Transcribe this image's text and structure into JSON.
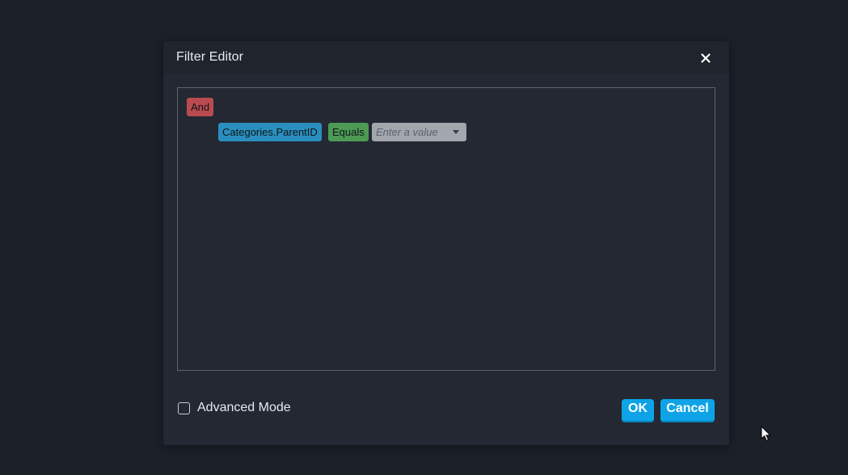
{
  "dialog": {
    "title": "Filter Editor",
    "close_icon": "close-icon"
  },
  "filter": {
    "group_operator": "And",
    "condition": {
      "field": "Categories.ParentID",
      "operator": "Equals",
      "value_placeholder": "Enter a value",
      "value_dropdown_icon": "caret-down-icon"
    }
  },
  "footer": {
    "advanced_mode_label": "Advanced Mode",
    "advanced_mode_checked": false,
    "ok_label": "OK",
    "cancel_label": "Cancel"
  },
  "colors": {
    "background": "#1c2029",
    "dialog": "#232833",
    "group_chip": "#b94a4f",
    "field_chip": "#2a8fbf",
    "operator_chip": "#4c9a53",
    "value_input": "#a2a6ad",
    "primary_button": "#0ea3e6"
  }
}
